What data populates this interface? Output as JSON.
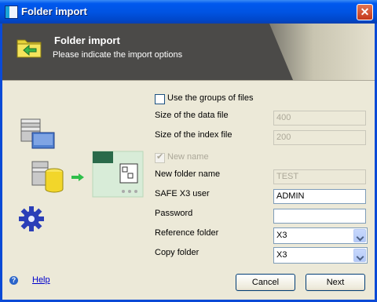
{
  "window": {
    "title": "Folder import"
  },
  "banner": {
    "title": "Folder import",
    "subtitle": "Please indicate the import options"
  },
  "form": {
    "use_groups_label": "Use the groups of files",
    "data_file_size": {
      "label": "Size of the data file",
      "value": "400"
    },
    "index_file_size": {
      "label": "Size of the index file",
      "value": "200"
    },
    "new_name_label": "New name",
    "new_folder_name": {
      "label": "New folder name",
      "value": "TEST"
    },
    "safe_user": {
      "label": "SAFE X3 user",
      "value": "ADMIN"
    },
    "password": {
      "label": "Password",
      "value": ""
    },
    "reference_folder": {
      "label": "Reference folder",
      "value": "X3"
    },
    "copy_folder": {
      "label": "Copy folder",
      "value": "X3"
    }
  },
  "footer": {
    "help_label": "Help",
    "cancel_label": "Cancel",
    "next_label": "Next"
  },
  "colors": {
    "title_bar": "#0054e3",
    "banner": "#4b4a48",
    "dialog_bg": "#ece9d8"
  }
}
